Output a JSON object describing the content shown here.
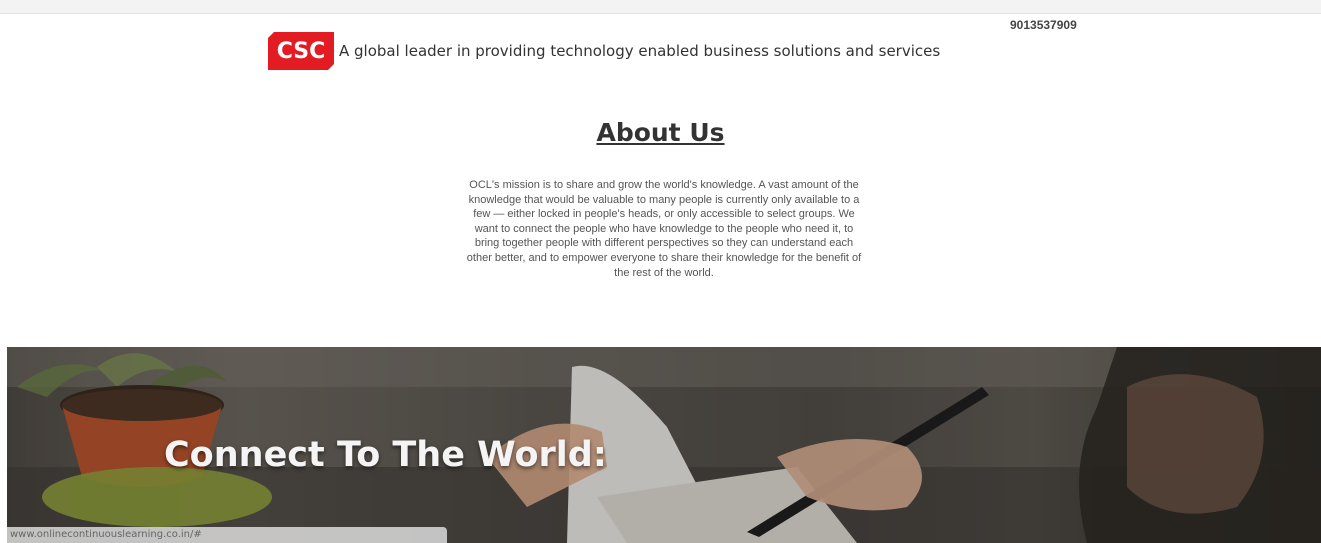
{
  "header": {
    "phone": "9013537909",
    "logo_text": "CSC",
    "tagline": "A global leader in providing technology enabled business solutions and services"
  },
  "about": {
    "title": "About Us",
    "text": "OCL's mission is to share and grow the world's knowledge. A vast amount of the knowledge that would be valuable to many people is currently only available to a few — either locked in people's heads, or only accessible to select groups. We want to connect the people who have knowledge to the people who need it, to bring together people with different perspectives so they can understand each other better, and to empower everyone to share their knowledge for the benefit of the rest of the world."
  },
  "hero": {
    "title": "Connect To The World:"
  },
  "status_bar": {
    "url": "www.onlinecontinuouslearning.co.in/#"
  },
  "colors": {
    "brand_red": "#e31b23",
    "text_dark": "#333333"
  }
}
